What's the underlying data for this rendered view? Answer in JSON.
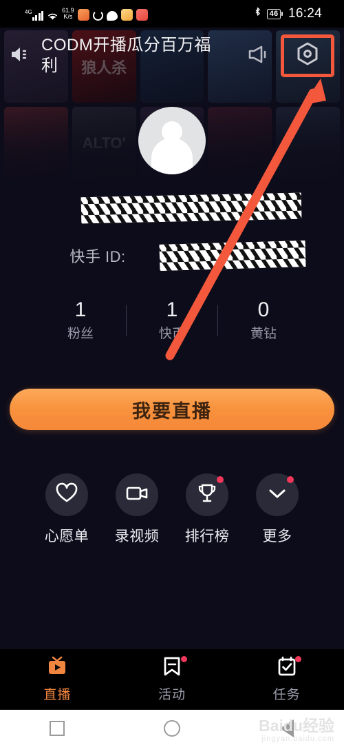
{
  "statusbar": {
    "network_type": "4G",
    "net_speed_value": "61.9",
    "net_speed_unit": "K/s",
    "app_icons": [
      "orange-app-icon",
      "loading-circle-icon",
      "chat-bubble-icon",
      "yellow-app-icon",
      "red-app-icon"
    ],
    "bluetooth_icon": "bluetooth-icon",
    "battery_level": "46",
    "clock": "16:24"
  },
  "header": {
    "speaker_icon": "speaker-icon",
    "title": "CODM开播瓜分百万福利",
    "megaphone_icon": "megaphone-icon",
    "settings_icon": "settings-hexagon-icon",
    "highlight_color": "#f4583c"
  },
  "profile": {
    "avatar_icon": "default-avatar-icon",
    "nickname": "",
    "nickname_redacted": true,
    "id_label": "快手 ID:",
    "id_value": "",
    "id_redacted": true
  },
  "stats": [
    {
      "value": "1",
      "label": "粉丝"
    },
    {
      "value": "1",
      "label": "快币"
    },
    {
      "value": "0",
      "label": "黄钻"
    }
  ],
  "cta": {
    "label": "我要直播",
    "color": "#f8913c",
    "text_color": "#3d2410"
  },
  "quick_actions": [
    {
      "label": "心愿单",
      "icon": "heart-icon",
      "badge": false
    },
    {
      "label": "录视频",
      "icon": "video-camera-icon",
      "badge": false
    },
    {
      "label": "排行榜",
      "icon": "trophy-icon",
      "badge": true
    },
    {
      "label": "更多",
      "icon": "chevron-down-icon",
      "badge": true
    }
  ],
  "bottom_nav": [
    {
      "label": "直播",
      "icon": "live-tv-icon",
      "active": true,
      "badge": false
    },
    {
      "label": "活动",
      "icon": "bookmark-icon",
      "active": false,
      "badge": true
    },
    {
      "label": "任务",
      "icon": "task-checkbox-icon",
      "active": false,
      "badge": true
    }
  ],
  "system_nav": [
    {
      "name": "recents-button",
      "icon": "square-icon"
    },
    {
      "name": "home-button",
      "icon": "circle-icon"
    },
    {
      "name": "back-button",
      "icon": "triangle-left-icon"
    }
  ],
  "watermark": {
    "line1": "Baidu经验",
    "line2": "jingyan.baidu.com"
  },
  "annotation": {
    "arrow_color": "#f4583c",
    "points_to": "settings-hexagon-icon"
  },
  "background_tiles": [
    {
      "glyph": "",
      "color1": "#3a2d46",
      "color2": "#211a2b"
    },
    {
      "glyph": "狼人杀",
      "color1": "#7e1414",
      "color2": "#2a0606"
    },
    {
      "glyph": "",
      "color1": "#1c3350",
      "color2": "#0d1626"
    },
    {
      "glyph": "",
      "color1": "#2f4a6b",
      "color2": "#16233a"
    },
    {
      "glyph": "",
      "color1": "#314a63",
      "color2": "#16222f"
    },
    {
      "glyph": "",
      "color1": "#7a2a2f",
      "color2": "#2b1014"
    },
    {
      "glyph": "ALTO'",
      "color1": "#34343f",
      "color2": "#16161d"
    },
    {
      "glyph": "",
      "color1": "#3a2a48",
      "color2": "#1a1222"
    },
    {
      "glyph": "",
      "color1": "#5a2030",
      "color2": "#220b12"
    },
    {
      "glyph": "",
      "color1": "#2c3a52",
      "color2": "#131a26"
    }
  ]
}
